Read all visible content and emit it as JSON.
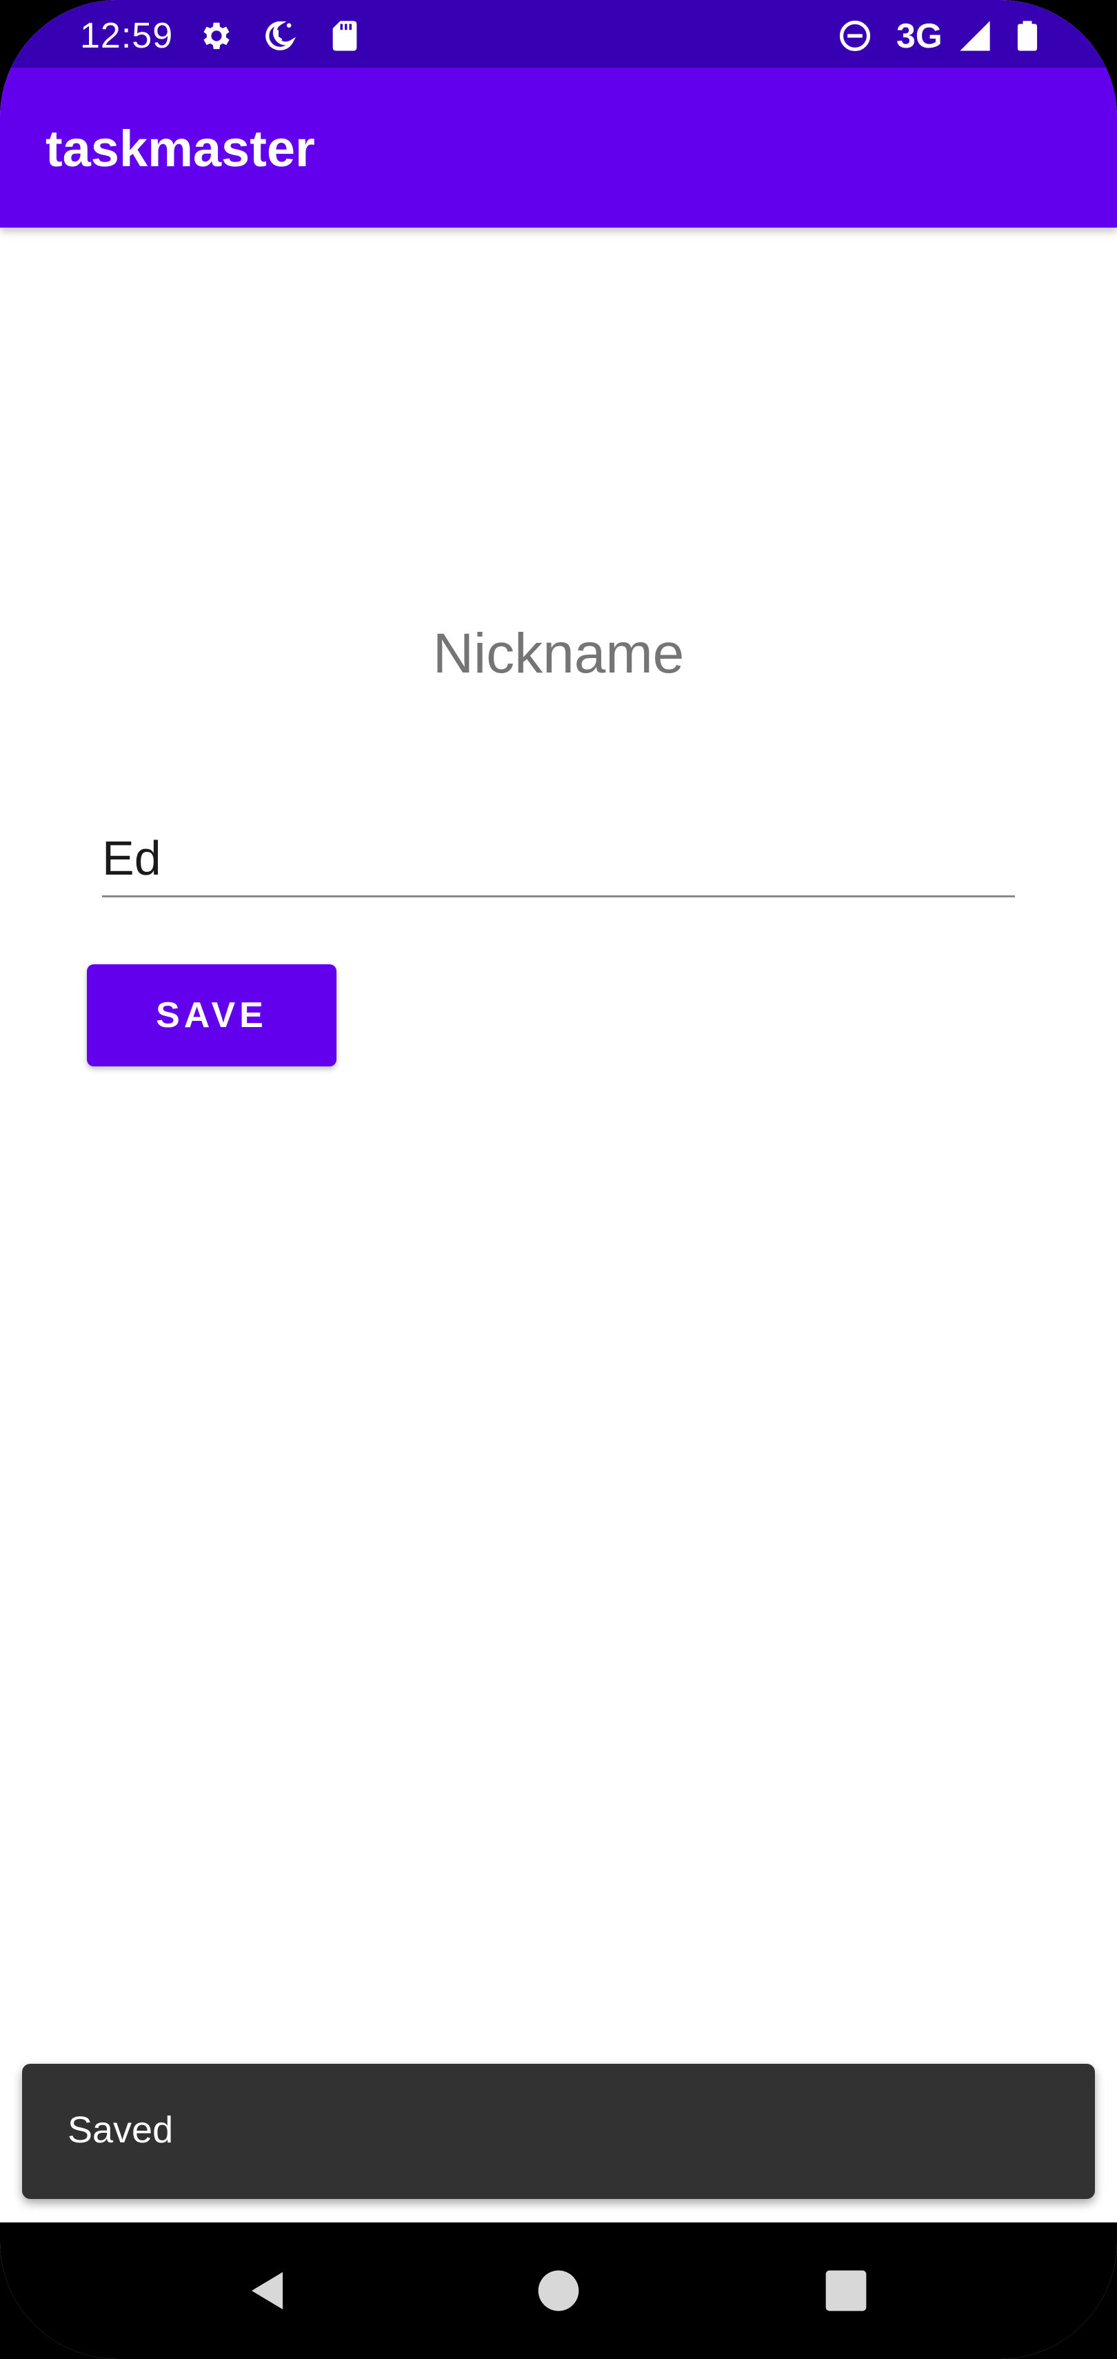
{
  "status_bar": {
    "time": "12:59",
    "network": "3G",
    "icons": [
      "gear-icon",
      "moon-clock-icon",
      "sd-card-icon",
      "dnd-icon",
      "signal-icon",
      "battery-icon"
    ]
  },
  "app_bar": {
    "title": "taskmaster"
  },
  "form": {
    "label": "Nickname",
    "input_value": "Ed",
    "save_label": "SAVE"
  },
  "snackbar": {
    "message": "Saved"
  },
  "nav_bar": {
    "icons": [
      "back-icon",
      "home-icon",
      "recents-icon"
    ]
  },
  "colors": {
    "status_bar": "#3700b3",
    "primary": "#6200ee",
    "snackbar": "#323232",
    "label": "#757575"
  }
}
